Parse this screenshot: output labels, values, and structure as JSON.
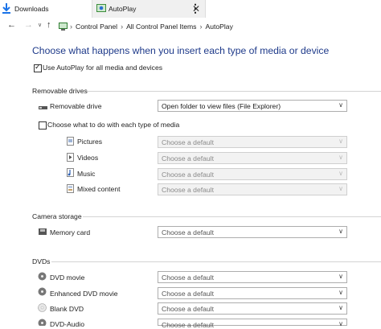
{
  "tabs": [
    {
      "label": "Downloads"
    },
    {
      "label": "AutoPlay"
    }
  ],
  "breadcrumbs": [
    "Control Panel",
    "All Control Panel Items",
    "AutoPlay"
  ],
  "heading": "Choose what happens when you insert each type of media or device",
  "use_autoplay": {
    "label": "Use AutoPlay for all media and devices",
    "checked": true
  },
  "removable": {
    "title": "Removable drives",
    "drive_label": "Removable drive",
    "drive_value": "Open folder to view files (File Explorer)",
    "choose_label": "Choose what to do with each type of media",
    "choose_checked": false,
    "media": [
      {
        "label": "Pictures",
        "value": "Choose a default"
      },
      {
        "label": "Videos",
        "value": "Choose a default"
      },
      {
        "label": "Music",
        "value": "Choose a default"
      },
      {
        "label": "Mixed content",
        "value": "Choose a default"
      }
    ]
  },
  "camera": {
    "title": "Camera storage",
    "items": [
      {
        "label": "Memory card",
        "value": "Choose a default"
      }
    ]
  },
  "dvds": {
    "title": "DVDs",
    "items": [
      {
        "label": "DVD movie",
        "value": "Choose a default"
      },
      {
        "label": "Enhanced DVD movie",
        "value": "Choose a default"
      },
      {
        "label": "Blank DVD",
        "value": "Choose a default"
      },
      {
        "label": "DVD-Audio",
        "value": "Choose a default"
      }
    ]
  },
  "colors": {
    "heading": "#1e3a8a",
    "download_arrow": "#1a73e8"
  }
}
